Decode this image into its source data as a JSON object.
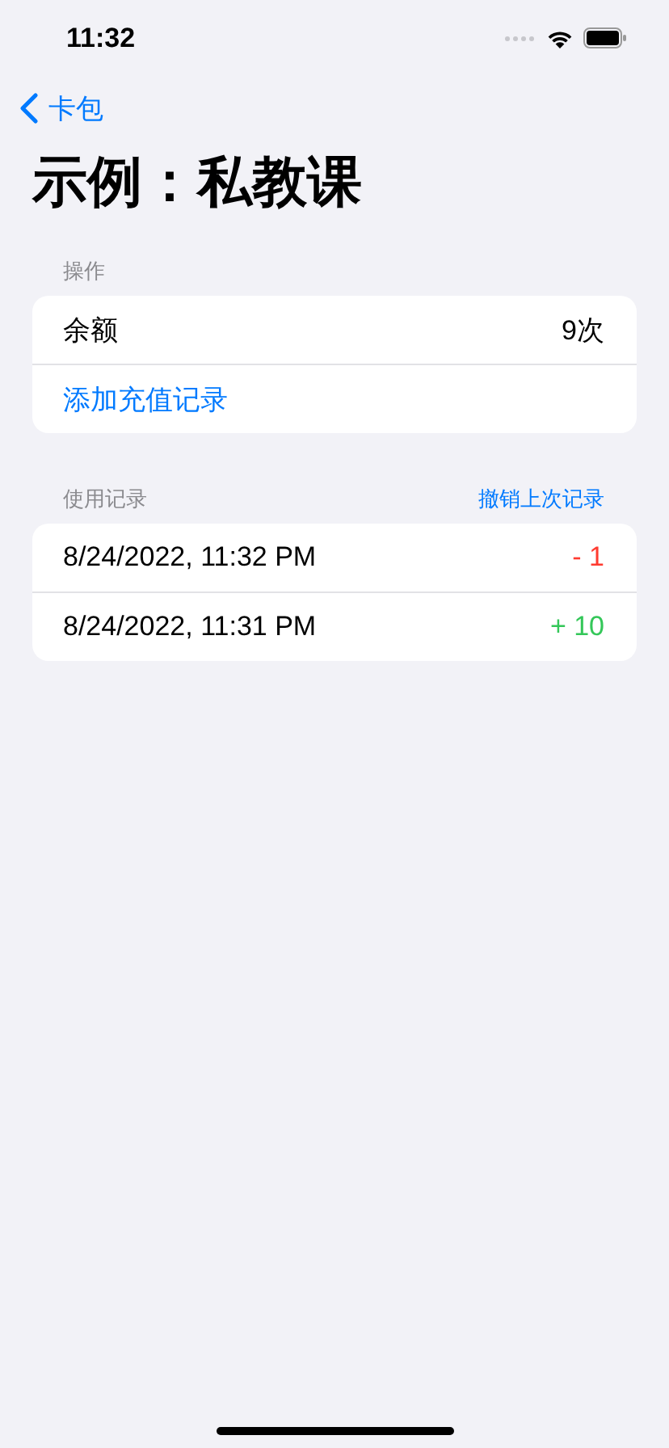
{
  "status_bar": {
    "time": "11:32"
  },
  "nav": {
    "back_label": "卡包"
  },
  "title": "示例：私教课",
  "operations": {
    "header": "操作",
    "balance_label": "余额",
    "balance_value": "9次",
    "add_link": "添加充值记录"
  },
  "usage": {
    "header": "使用记录",
    "undo_link": "撤销上次记录",
    "records": [
      {
        "time": "8/24/2022, 11:32 PM",
        "change": "- 1",
        "color": "#ff3b30"
      },
      {
        "time": "8/24/2022, 11:31 PM",
        "change": "+ 10",
        "color": "#34c759"
      }
    ]
  }
}
